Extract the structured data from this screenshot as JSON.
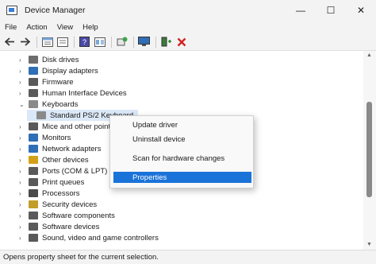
{
  "window": {
    "title": "Device Manager",
    "minimize": "—",
    "maximize": "☐",
    "close": "✕"
  },
  "menu": [
    "File",
    "Action",
    "View",
    "Help"
  ],
  "toolbar": {
    "buttons": [
      "back-icon",
      "forward-icon",
      "properties-sheet-icon",
      "show-hide-icon",
      "help-icon",
      "view-icon",
      "scan-hardware-icon",
      "monitor-icon",
      "update-driver-icon",
      "uninstall-icon"
    ]
  },
  "tree": {
    "items": [
      {
        "label": "Disk drives",
        "icon": "disk-icon",
        "color": "#6d6d6d"
      },
      {
        "label": "Display adapters",
        "icon": "display-icon",
        "color": "#2f6fb5"
      },
      {
        "label": "Firmware",
        "icon": "firmware-icon",
        "color": "#5a5a5a"
      },
      {
        "label": "Human Interface Devices",
        "icon": "hid-icon",
        "color": "#5a5a5a"
      },
      {
        "label": "Keyboards",
        "icon": "keyboard-icon",
        "color": "#8a8a8a"
      },
      {
        "label": "Standard PS/2 Keyboard",
        "icon": "keyboard-icon",
        "color": "#8a8a8a"
      },
      {
        "label": "Mice and other pointing devices",
        "icon": "mouse-icon",
        "color": "#5a5a5a"
      },
      {
        "label": "Monitors",
        "icon": "monitor-icon",
        "color": "#2f6fb5"
      },
      {
        "label": "Network adapters",
        "icon": "network-icon",
        "color": "#2f6fb5"
      },
      {
        "label": "Other devices",
        "icon": "other-devices-icon",
        "color": "#d4a017"
      },
      {
        "label": "Ports (COM & LPT)",
        "icon": "port-icon",
        "color": "#5a5a5a"
      },
      {
        "label": "Print queues",
        "icon": "printer-icon",
        "color": "#5a5a5a"
      },
      {
        "label": "Processors",
        "icon": "processor-icon",
        "color": "#4a4a4a"
      },
      {
        "label": "Security devices",
        "icon": "security-icon",
        "color": "#c29d2a"
      },
      {
        "label": "Software components",
        "icon": "software-icon",
        "color": "#5a5a5a"
      },
      {
        "label": "Software devices",
        "icon": "software-icon",
        "color": "#5a5a5a"
      },
      {
        "label": "Sound, video and game controllers",
        "icon": "sound-icon",
        "color": "#5a5a5a"
      }
    ]
  },
  "context_menu": {
    "items": [
      "Update driver",
      "Uninstall device",
      "Scan for hardware changes",
      "Properties"
    ],
    "selected": "Properties"
  },
  "status": "Opens property sheet for the current selection."
}
